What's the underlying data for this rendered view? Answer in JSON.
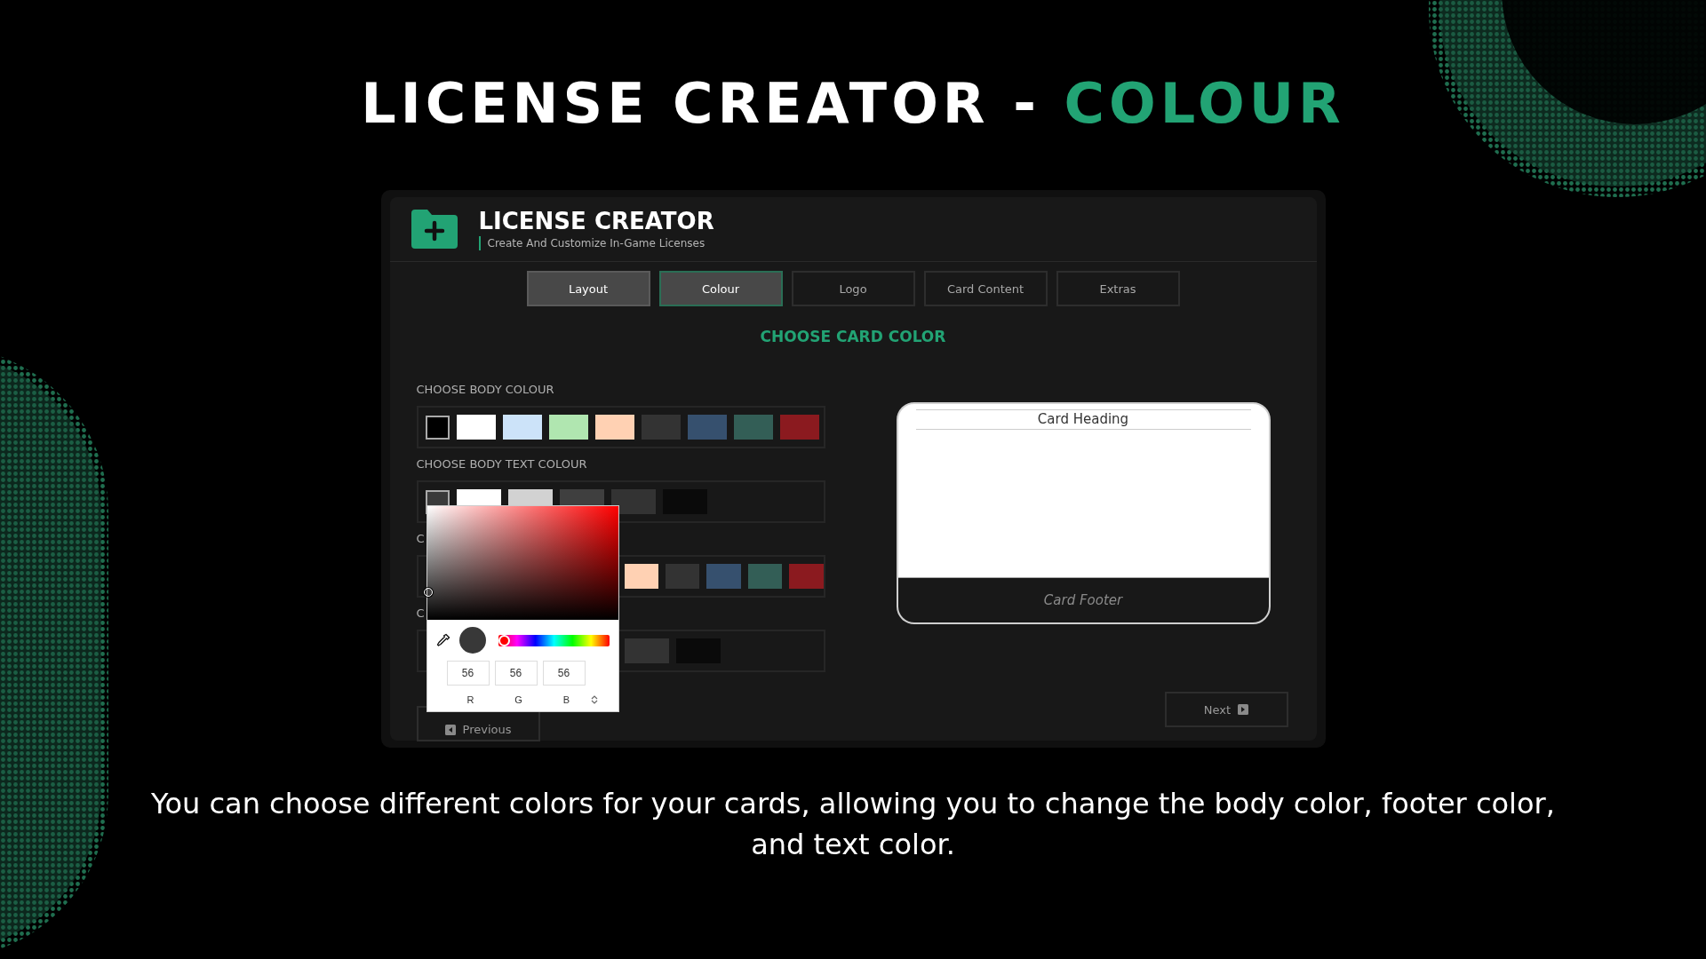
{
  "headline": {
    "lead": "LICENSE CREATOR -",
    "accent": "COLOUR"
  },
  "app": {
    "title": "LICENSE CREATOR",
    "subtitle": "Create And Customize In-Game Licenses"
  },
  "tabs": [
    {
      "label": "Layout",
      "done": true,
      "selected": false
    },
    {
      "label": "Colour",
      "done": true,
      "selected": true
    },
    {
      "label": "Logo",
      "done": false,
      "selected": false
    },
    {
      "label": "Card Content",
      "done": false,
      "selected": false
    },
    {
      "label": "Extras",
      "done": false,
      "selected": false
    }
  ],
  "section_title": "CHOOSE CARD COLOR",
  "colour_groups": [
    {
      "label": "CHOOSE BODY COLOUR",
      "partly_hidden": false,
      "swatches": [
        {
          "color": "#000000",
          "selected": true
        },
        {
          "color": "#ffffff",
          "selected": false
        },
        {
          "color": "#cce3f9",
          "selected": false
        },
        {
          "color": "#b0e6b0",
          "selected": false
        },
        {
          "color": "#ffd1b3",
          "selected": false
        },
        {
          "color": "#333333",
          "selected": false
        },
        {
          "color": "#36506e",
          "selected": false
        },
        {
          "color": "#335e56",
          "selected": false
        },
        {
          "color": "#8b1a1f",
          "selected": false
        }
      ]
    },
    {
      "label": "CHOOSE BODY TEXT COLOUR",
      "partly_hidden": false,
      "swatches": [
        {
          "color": "#3a3a3a",
          "selected": true
        },
        {
          "color": "#ffffff",
          "selected": false
        },
        {
          "color": "#d2d2d2",
          "selected": false
        },
        {
          "color": "#3f3f3f",
          "selected": false
        },
        {
          "color": "#333333",
          "selected": false
        },
        {
          "color": "#0a0a0a",
          "selected": false
        }
      ]
    },
    {
      "label": "C",
      "partly_hidden": true,
      "swatches": [
        {
          "color": "#ffd1b3",
          "selected": false
        },
        {
          "color": "#333333",
          "selected": false
        },
        {
          "color": "#36506e",
          "selected": false
        },
        {
          "color": "#335e56",
          "selected": false
        },
        {
          "color": "#8b1a1f",
          "selected": false
        }
      ]
    },
    {
      "label": "C",
      "partly_hidden": true,
      "swatches": [
        {
          "color": "#333333",
          "selected": false
        },
        {
          "color": "#0a0a0a",
          "selected": false
        }
      ]
    }
  ],
  "picker": {
    "hue": {
      "level": 0
    },
    "channels": [
      {
        "value": "56",
        "label": "R"
      },
      {
        "value": "56",
        "label": "G"
      },
      {
        "value": "56",
        "label": "B"
      }
    ]
  },
  "card_preview": {
    "heading": "Card Heading",
    "footer": "Card Footer"
  },
  "nav": {
    "previous": "Previous",
    "next": "Next"
  },
  "caption": "You can choose different colors for your cards, allowing you to change the body color, footer color, and text color."
}
